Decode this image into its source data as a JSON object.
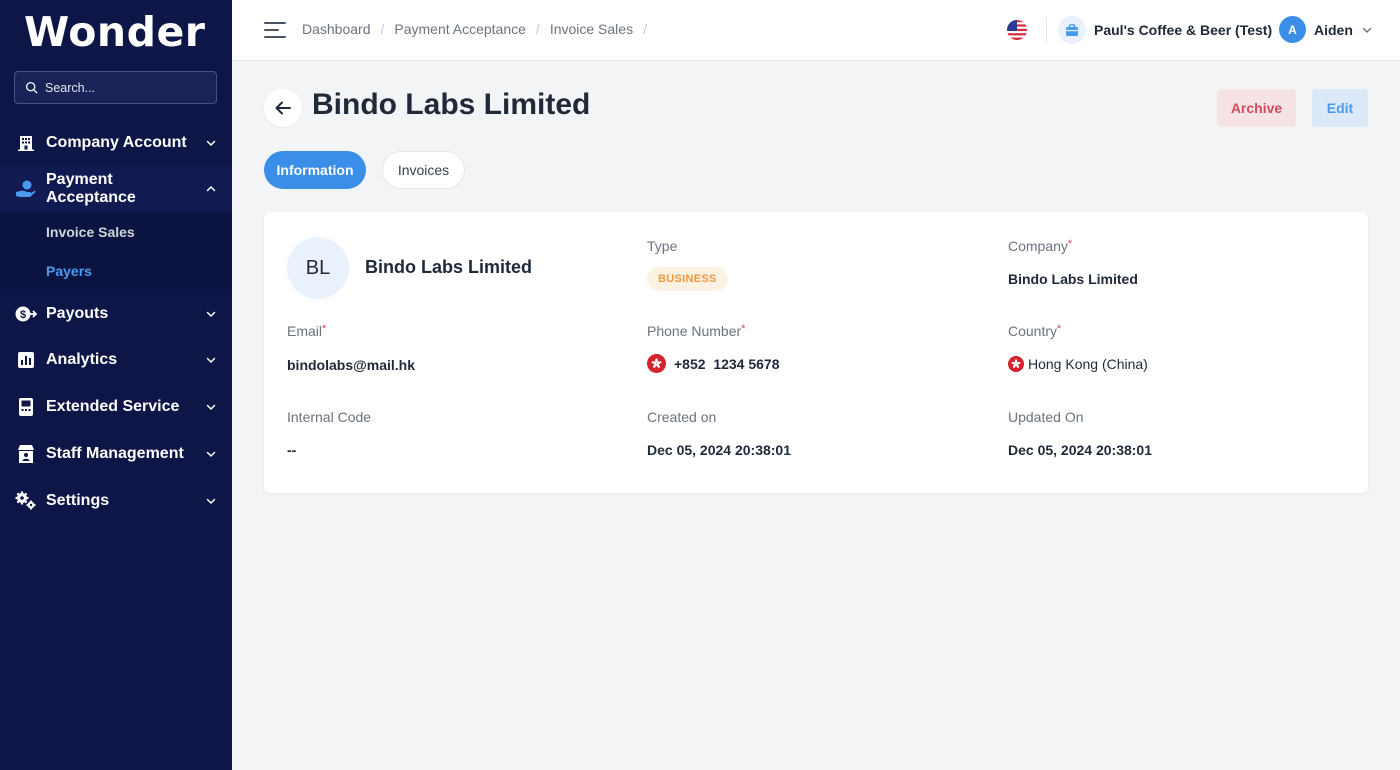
{
  "brand": {
    "logo": "Wonder"
  },
  "search": {
    "placeholder": "Search..."
  },
  "sidebar": {
    "items": [
      {
        "label": "Company Account",
        "icon": "building-icon"
      },
      {
        "label": "Payment Acceptance",
        "icon": "hand-coin-icon",
        "expanded": true,
        "children": [
          {
            "label": "Invoice Sales",
            "active": false
          },
          {
            "label": "Payers",
            "active": true
          }
        ]
      },
      {
        "label": "Payouts",
        "icon": "dollar-arrow-icon"
      },
      {
        "label": "Analytics",
        "icon": "bar-chart-icon"
      },
      {
        "label": "Extended Service",
        "icon": "terminal-icon"
      },
      {
        "label": "Staff Management",
        "icon": "store-person-icon"
      },
      {
        "label": "Settings",
        "icon": "gears-icon"
      }
    ]
  },
  "topbar": {
    "breadcrumbs": [
      "Dashboard",
      "Payment Acceptance",
      "Invoice Sales"
    ],
    "store_name": "Paul's Coffee & Beer (Test)",
    "user_initial": "A",
    "user_name": "Aiden"
  },
  "page": {
    "title": "Bindo Labs Limited",
    "archive_label": "Archive",
    "edit_label": "Edit",
    "tabs": [
      {
        "label": "Information",
        "active": true
      },
      {
        "label": "Invoices",
        "active": false
      }
    ]
  },
  "payer": {
    "initials": "BL",
    "name": "Bindo Labs Limited",
    "type_label": "Type",
    "type_value": "BUSINESS",
    "company_label": "Company",
    "company_value": "Bindo Labs Limited",
    "email_label": "Email",
    "email_value": "bindolabs@mail.hk",
    "phone_label": "Phone Number",
    "phone_value": "+852  1234 5678",
    "country_label": "Country",
    "country_value": "Hong Kong (China)",
    "internal_code_label": "Internal Code",
    "internal_code_value": "--",
    "created_label": "Created on",
    "created_value": "Dec 05, 2024 20:38:01",
    "updated_label": "Updated On",
    "updated_value": "Dec 05, 2024 20:38:01",
    "required_mark": "*"
  },
  "colors": {
    "sidebar_bg": "#0d1647",
    "accent": "#3b8ee8",
    "active_sub": "#4a9bf0",
    "archive_text": "#d14a5e",
    "badge_text": "#ef9a3a",
    "required": "#e0405a"
  }
}
